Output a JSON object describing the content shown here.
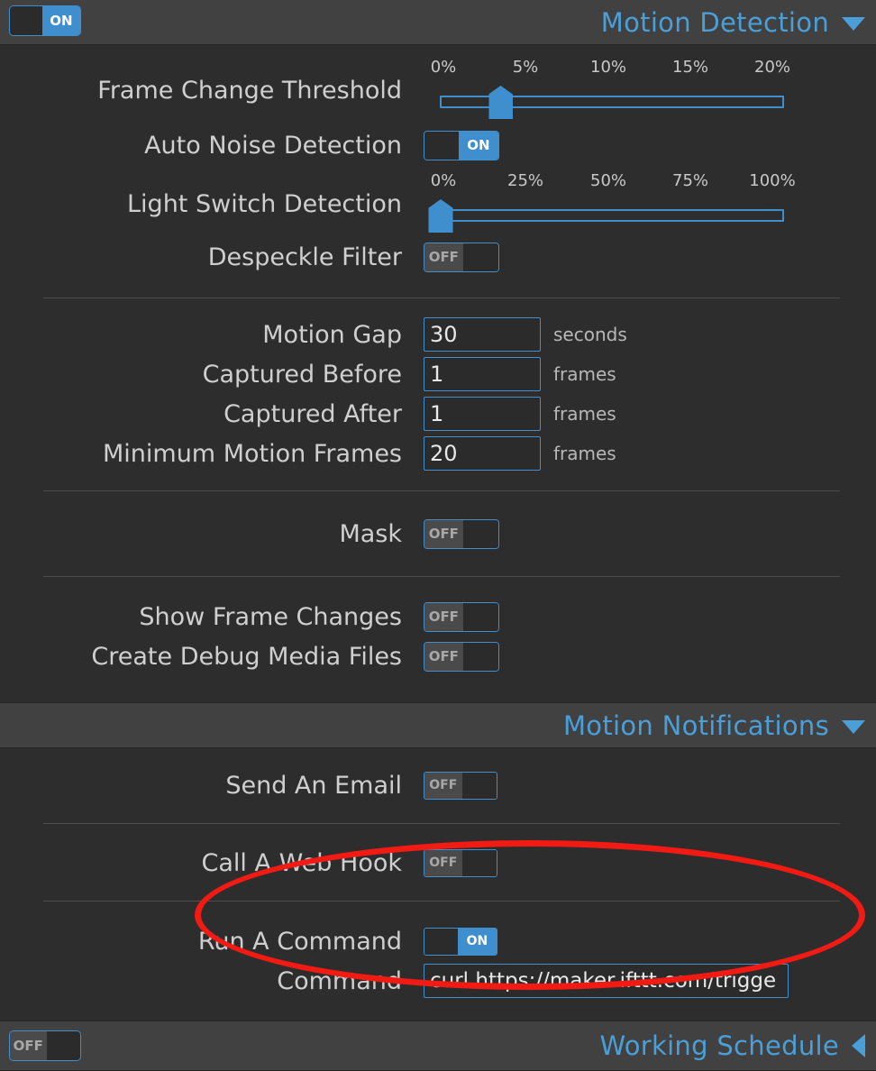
{
  "colors": {
    "background": "#2d2d2d",
    "header_band": "#414141",
    "accent_blue": "#4a9fd8",
    "control_blue": "#3f8fce",
    "label_text": "#cfcfcf",
    "annotation_red": "#f11b14"
  },
  "sections": {
    "motion_detection": {
      "title": "Motion Detection",
      "caret": "chevron-down-icon",
      "enabled_toggle": {
        "state": "on",
        "label": "ON"
      },
      "rows": [
        {
          "label": "Frame Change Threshold",
          "type": "slider",
          "ticks": [
            "0%",
            "5%",
            "10%",
            "15%",
            "20%"
          ],
          "value_percent": 3.5
        },
        {
          "label": "Auto Noise Detection",
          "type": "toggle",
          "state": "on",
          "toggle_label": "ON"
        },
        {
          "label": "Light Switch Detection",
          "type": "slider",
          "ticks": [
            "0%",
            "25%",
            "50%",
            "75%",
            "100%"
          ],
          "value_percent": 0
        },
        {
          "label": "Despeckle Filter",
          "type": "toggle",
          "state": "off",
          "toggle_label": "OFF"
        }
      ],
      "numeric_rows": [
        {
          "label": "Motion Gap",
          "value": "30",
          "unit": "seconds"
        },
        {
          "label": "Captured Before",
          "value": "1",
          "unit": "frames"
        },
        {
          "label": "Captured After",
          "value": "1",
          "unit": "frames"
        },
        {
          "label": "Minimum Motion Frames",
          "value": "20",
          "unit": "frames"
        }
      ],
      "mask_row": {
        "label": "Mask",
        "state": "off",
        "toggle_label": "OFF"
      },
      "debug_rows": [
        {
          "label": "Show Frame Changes",
          "state": "off",
          "toggle_label": "OFF"
        },
        {
          "label": "Create Debug Media Files",
          "state": "off",
          "toggle_label": "OFF"
        }
      ]
    },
    "motion_notifications": {
      "title": "Motion Notifications",
      "caret": "chevron-down-icon",
      "rows": [
        {
          "label": "Send An Email",
          "state": "off",
          "toggle_label": "OFF"
        },
        {
          "label": "Call A Web Hook",
          "state": "off",
          "toggle_label": "OFF"
        },
        {
          "label": "Run A Command",
          "state": "on",
          "toggle_label": "ON"
        }
      ],
      "command_row": {
        "label": "Command",
        "value": "curl https://maker.ifttt.com/trigge",
        "placeholder": ""
      }
    },
    "working_schedule": {
      "title": "Working Schedule",
      "caret": "chevron-left-icon",
      "enabled_toggle": {
        "state": "off",
        "label": "OFF"
      }
    }
  },
  "annotation": {
    "shape": "ellipse",
    "color": "#f11b14"
  }
}
